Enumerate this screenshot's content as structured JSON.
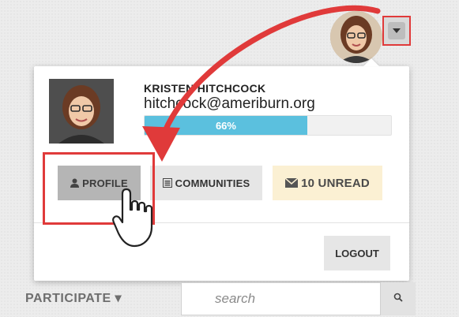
{
  "user": {
    "name": "KRISTEN HITCHCOCK",
    "email": "hitchcock@ameriburn.org",
    "profile_completion": 0.66,
    "profile_completion_label": "66%"
  },
  "buttons": {
    "profile": "PROFILE",
    "communities": "COMMUNITIES",
    "unread": "10 UNREAD",
    "logout": "LOGOUT"
  },
  "nav": {
    "participate": "PARTICIPATE ▾"
  },
  "search": {
    "placeholder": "search"
  },
  "icons": {
    "dropdown": "caret-down-icon",
    "profile": "user-icon",
    "communities": "list-icon",
    "unread": "envelope-icon",
    "search": "search-icon",
    "cursor": "hand-pointer-icon"
  },
  "colors": {
    "progress": "#5bc0de",
    "annotation": "#e03a3a",
    "unread_bg": "#fbf0d3",
    "profile_bg": "#b5b5b5"
  }
}
